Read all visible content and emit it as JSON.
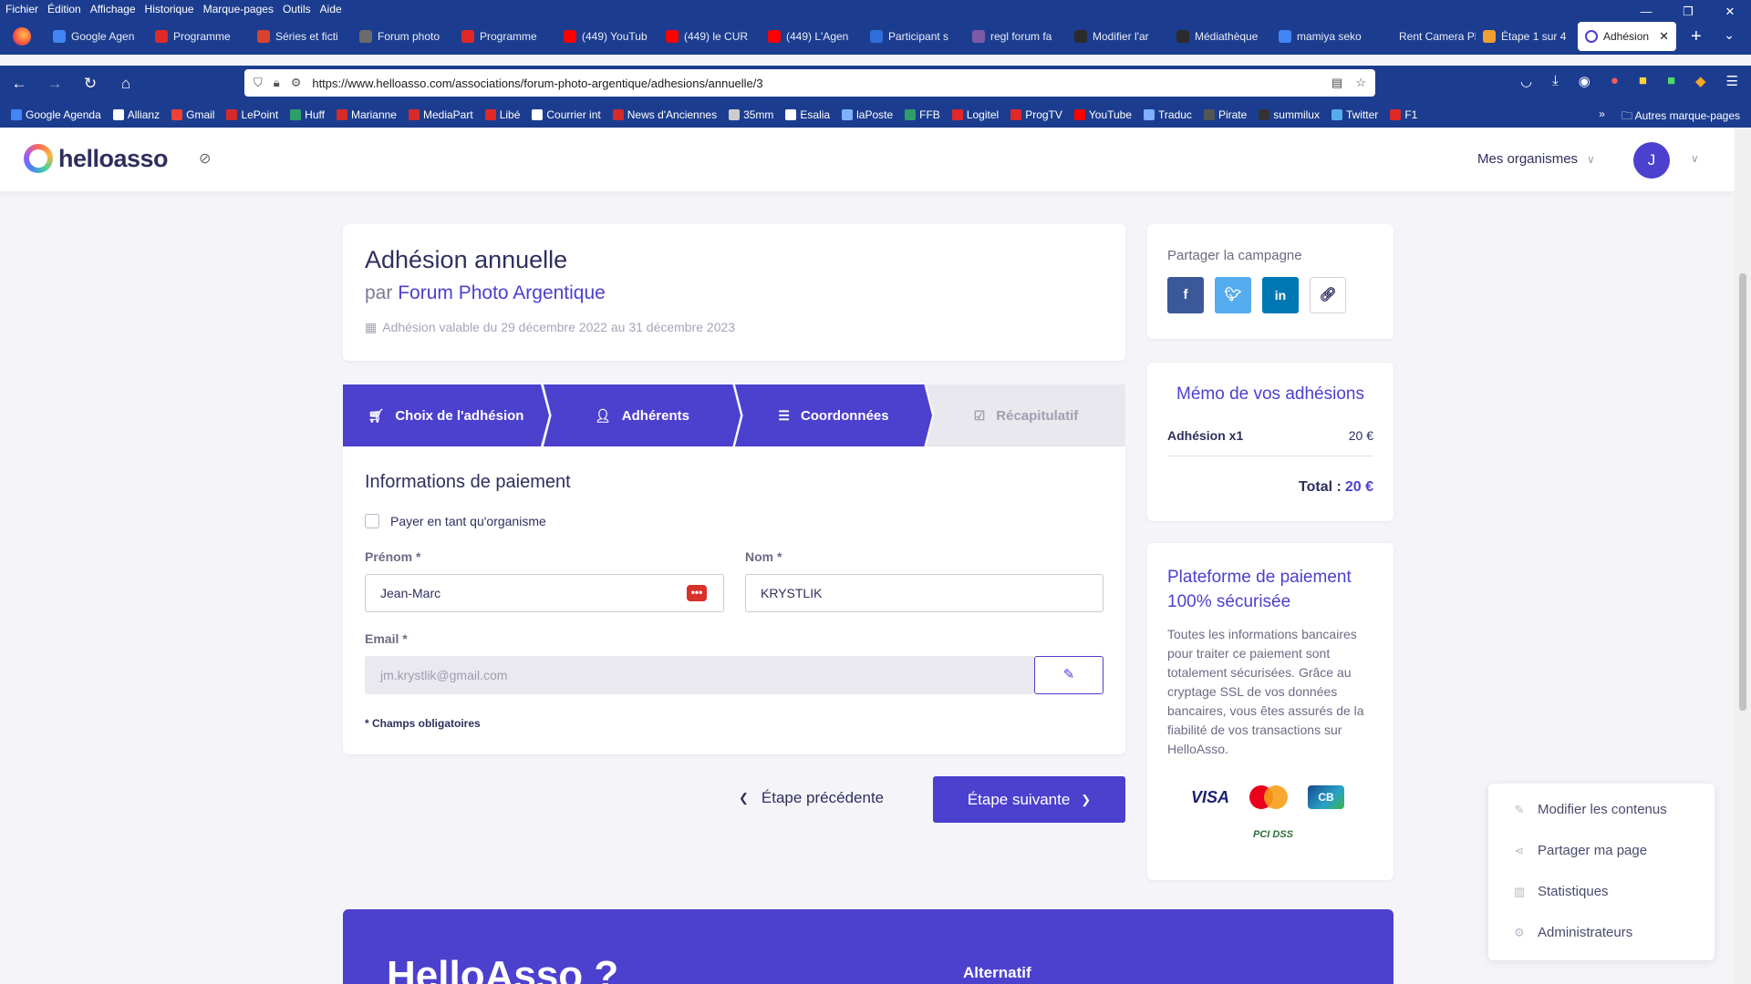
{
  "browser": {
    "menu": [
      "Fichier",
      "Édition",
      "Affichage",
      "Historique",
      "Marque-pages",
      "Outils",
      "Aide"
    ],
    "tabs": [
      {
        "label": "Google Agen",
        "color": "#4285f4"
      },
      {
        "label": "Programme",
        "color": "#e02828"
      },
      {
        "label": "Séries et ficti",
        "color": "#d9432f"
      },
      {
        "label": "Forum photo",
        "color": "#6b6b6b"
      },
      {
        "label": "Programme",
        "color": "#e02828"
      },
      {
        "label": "(449) YouTub",
        "color": "#ff0000"
      },
      {
        "label": "(449) le CUR",
        "color": "#ff0000"
      },
      {
        "label": "(449) L'Agen",
        "color": "#ff0000"
      },
      {
        "label": "Participant s",
        "color": "#2f6fdc"
      },
      {
        "label": "regl forum fa",
        "color": "#7b5ba8"
      },
      {
        "label": "Modifier l'ar",
        "color": "#2b2b2b"
      },
      {
        "label": "Médiathèque",
        "color": "#2b2b2b"
      },
      {
        "label": "mamiya seko",
        "color": "#4285f4"
      },
      {
        "label": "Rent Camera Pho",
        "color": "#1c3d8f"
      },
      {
        "label": "Étape 1 sur 4",
        "color": "#f0a030"
      }
    ],
    "active_tab": "Adhésion",
    "url": "https://www.helloasso.com/associations/forum-photo-argentique/adhesions/annuelle/3",
    "bookmarks": [
      {
        "label": "Google Agenda",
        "color": "#4285f4"
      },
      {
        "label": "Allianz",
        "color": "#ffffff"
      },
      {
        "label": "Gmail",
        "color": "#ea4335"
      },
      {
        "label": "LePoint",
        "color": "#d62b2b"
      },
      {
        "label": "Huff",
        "color": "#2e9e6a"
      },
      {
        "label": "Marianne",
        "color": "#d62b2b"
      },
      {
        "label": "MediaPart",
        "color": "#d62b2b"
      },
      {
        "label": "Libé",
        "color": "#e02828"
      },
      {
        "label": "Courrier int",
        "color": "#ffffff"
      },
      {
        "label": "News d'Anciennes",
        "color": "#d62b2b"
      },
      {
        "label": "35mm",
        "color": "#cccccc"
      },
      {
        "label": "Esalia",
        "color": "#ffffff"
      },
      {
        "label": "laPoste",
        "color": "#7fb0ff"
      },
      {
        "label": "FFB",
        "color": "#2e9e6a"
      },
      {
        "label": "Logitel",
        "color": "#e02828"
      },
      {
        "label": "ProgTV",
        "color": "#e02828"
      },
      {
        "label": "YouTube",
        "color": "#ff0000"
      },
      {
        "label": "Traduc",
        "color": "#7fb0ff"
      },
      {
        "label": "Pirate",
        "color": "#555555"
      },
      {
        "label": "summilux",
        "color": "#333333"
      },
      {
        "label": "Twitter",
        "color": "#55acee"
      },
      {
        "label": "F1",
        "color": "#e02828"
      }
    ],
    "other_bookmarks": "Autres marque-pages"
  },
  "header": {
    "logo": "helloasso",
    "orgs_label": "Mes organismes",
    "avatar_initial": "J"
  },
  "campaign": {
    "title": "Adhésion annuelle",
    "by_prefix": "par",
    "organization": "Forum Photo Argentique",
    "validity": "Adhésion valable du 29 décembre 2022 au 31 décembre 2023"
  },
  "steps": [
    {
      "label": "Choix de l'adhésion",
      "icon": "cart-icon",
      "status": "done"
    },
    {
      "label": "Adhérents",
      "icon": "user-icon",
      "status": "done"
    },
    {
      "label": "Coordonnées",
      "icon": "list-icon",
      "status": "current"
    },
    {
      "label": "Récapitulatif",
      "icon": "check-icon",
      "status": "pending"
    }
  ],
  "form": {
    "title": "Informations de paiement",
    "pay_as_org_label": "Payer en tant qu'organisme",
    "pay_as_org_checked": false,
    "firstname_label": "Prénom *",
    "firstname_value": "Jean-Marc",
    "lastname_label": "Nom *",
    "lastname_value": "KRYSTLIK",
    "email_label": "Email *",
    "email_value": "jm.krystlik@gmail.com",
    "required_note": "* Champs obligatoires"
  },
  "nav": {
    "prev_label": "Étape précédente",
    "next_label": "Étape suivante"
  },
  "share": {
    "title": "Partager la campagne",
    "facebook": "f",
    "linkedin": "in"
  },
  "memo": {
    "title": "Mémo de vos adhésions",
    "item_name": "Adhésion x1",
    "item_price": "20 €",
    "total_label": "Total :",
    "total_amount": "20 €"
  },
  "secure": {
    "title": "Plateforme de paiement 100% sécurisée",
    "text": "Toutes les informations bancaires pour traiter ce paiement sont totalement sécurisées. Grâce au cryptage SSL de vos données bancaires, vous êtes assurés de la fiabilité de vos transactions sur HelloAsso.",
    "visa": "VISA",
    "cb": "CB",
    "pci": "PCI DSS"
  },
  "admin_menu": [
    {
      "label": "Modifier les contenus",
      "icon": "pencil-icon"
    },
    {
      "label": "Partager ma page",
      "icon": "share-icon"
    },
    {
      "label": "Statistiques",
      "icon": "chart-icon"
    },
    {
      "label": "Administrateurs",
      "icon": "gear-icon"
    }
  ],
  "footer": {
    "title": "HelloAsso ?",
    "alt": "Alternatif"
  },
  "colors": {
    "brand": "#4c40cf",
    "browser_chrome": "#1c3d8f"
  }
}
